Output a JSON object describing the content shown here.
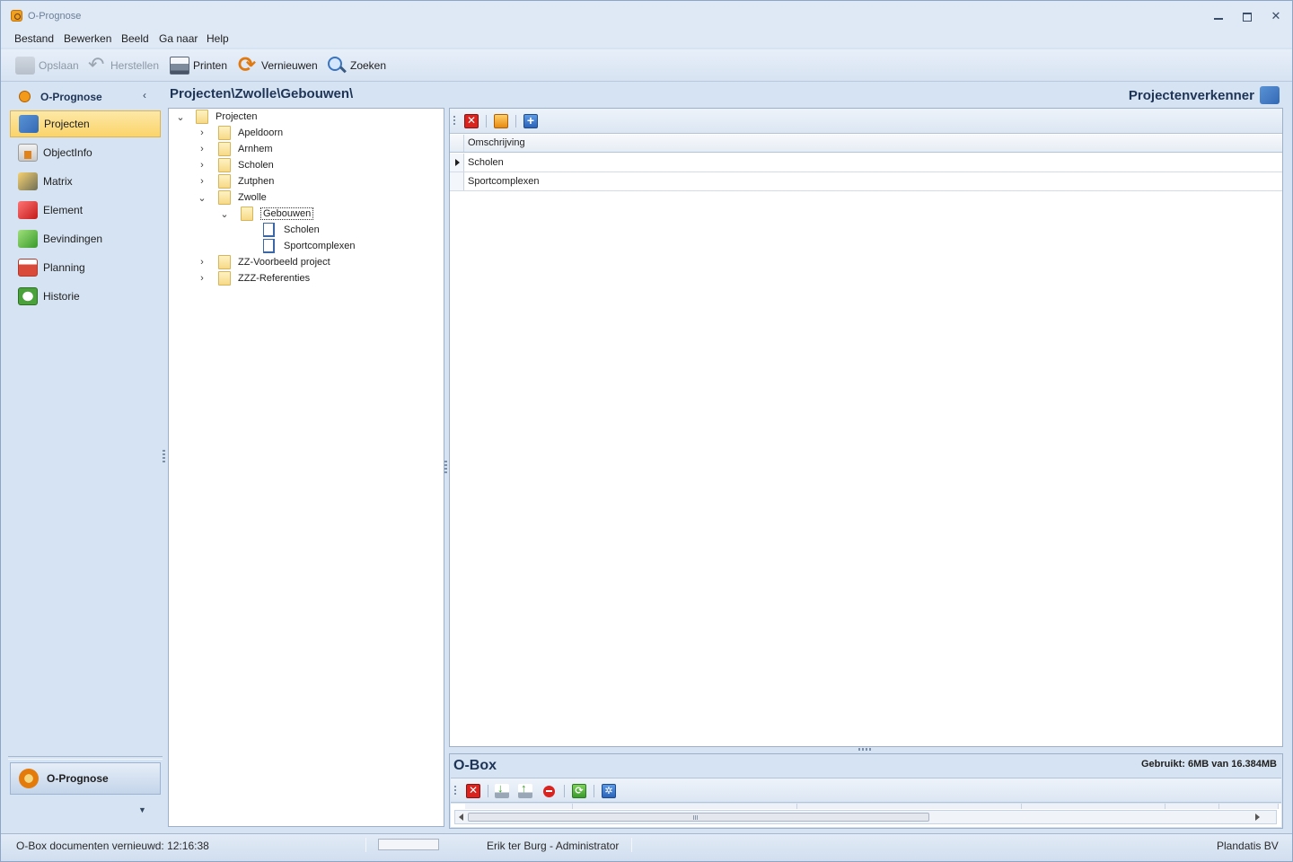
{
  "window": {
    "title": "O-Prognose"
  },
  "menu": [
    "Bestand",
    "Bewerken",
    "Beeld",
    "Ga naar",
    "Help"
  ],
  "toolbar": {
    "save": "Opslaan",
    "undo": "Herstellen",
    "print": "Printen",
    "refresh": "Vernieuwen",
    "search": "Zoeken"
  },
  "nav": {
    "header": "O-Prognose",
    "items": [
      {
        "label": "Projecten",
        "icon": "projects-icon",
        "active": true
      },
      {
        "label": "ObjectInfo",
        "icon": "house-icon"
      },
      {
        "label": "Matrix",
        "icon": "matrix-folder-icon"
      },
      {
        "label": "Element",
        "icon": "element-folder-icon"
      },
      {
        "label": "Bevindingen",
        "icon": "findings-folder-icon"
      },
      {
        "label": "Planning",
        "icon": "calendar-icon"
      },
      {
        "label": "Historie",
        "icon": "history-clock-icon"
      }
    ],
    "bottom": "O-Prognose"
  },
  "breadcrumb": "Projecten\\Zwolle\\Gebouwen\\",
  "explorer_title": "Projectenverkenner",
  "tree": {
    "root": "Projecten",
    "children": [
      "Apeldoorn",
      "Arnhem",
      "Scholen",
      "Zutphen",
      "Zwolle"
    ],
    "zwolle_child": "Gebouwen",
    "gebouwen_children": [
      "Scholen",
      "Sportcomplexen"
    ],
    "after": [
      "ZZ-Voorbeeld project",
      "ZZZ-Referenties"
    ]
  },
  "grid": {
    "column": "Omschrijving",
    "rows": [
      "Scholen",
      "Sportcomplexen"
    ]
  },
  "obox": {
    "title": "O-Box",
    "used": "Gebruikt: 6MB van 16.384MB"
  },
  "status": {
    "refreshed": "O-Box documenten vernieuwd: 12:16:38",
    "user": "Erik ter Burg - Administrator",
    "company": "Plandatis BV"
  }
}
